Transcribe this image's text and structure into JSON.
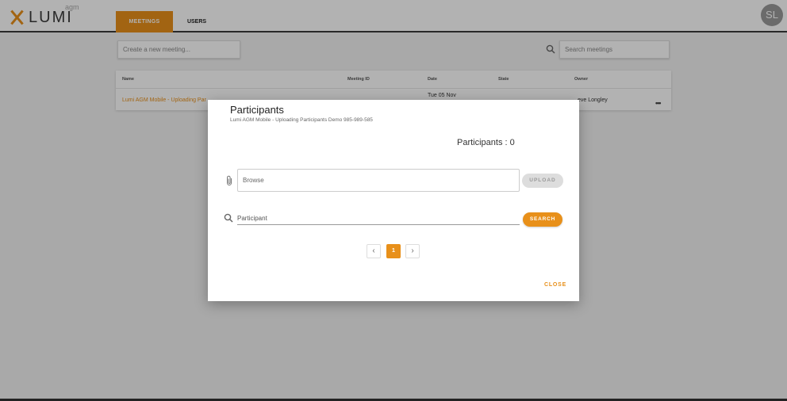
{
  "header": {
    "logo_text": "LUMI",
    "logo_sub": "agm",
    "tabs": [
      {
        "label": "MEETINGS",
        "active": true
      },
      {
        "label": "USERS",
        "active": false
      }
    ],
    "avatar_initials": "SL"
  },
  "toolbar": {
    "create_placeholder": "Create a new meeting...",
    "search_placeholder": "Search meetings"
  },
  "table": {
    "columns": [
      "Name",
      "Meeting ID",
      "Date",
      "State",
      "Owner"
    ],
    "rows": [
      {
        "name": "Lumi AGM Mobile - Uploading Par",
        "date": "Tue 05 Nov",
        "owner": "eve Longley"
      }
    ]
  },
  "modal": {
    "title": "Participants",
    "subtitle": "Lumi AGM Mobile - Uploading Participants Demo 985-989-585",
    "count_text": "Participants : 0",
    "browse_placeholder": "Browse",
    "upload_label": "UPLOAD",
    "participant_placeholder": "Participant",
    "search_label": "SEARCH",
    "pagination": {
      "current_page": "1",
      "prev_icon": "chevron-left-icon",
      "next_icon": "chevron-right-icon"
    },
    "close_label": "CLOSE"
  },
  "colors": {
    "accent": "#e8901a",
    "overlay": "rgba(0,0,0,0.30)"
  }
}
